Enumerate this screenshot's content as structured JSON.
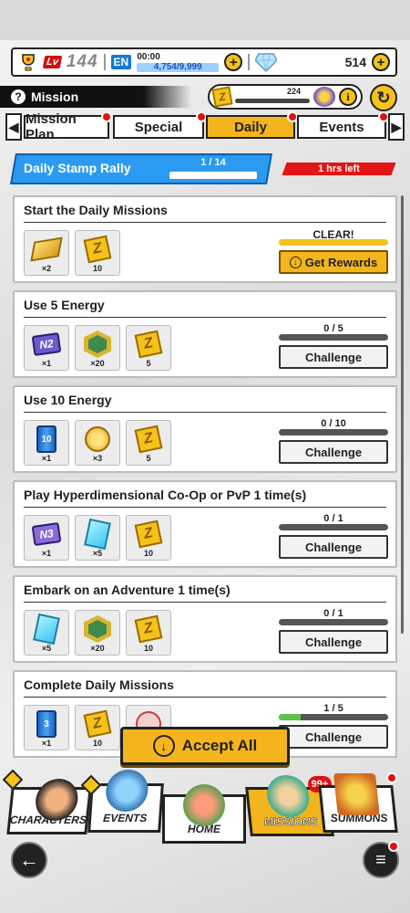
{
  "player": {
    "level_tag": "Lv",
    "level": "144",
    "en_tag": "EN",
    "en_timer": "00:00",
    "energy": "4,754/9,999",
    "gems": "514"
  },
  "header": {
    "title": "Mission",
    "z_points": "224"
  },
  "tabs": [
    {
      "label": "Mission Plan"
    },
    {
      "label": "Special"
    },
    {
      "label": "Daily"
    },
    {
      "label": "Events"
    }
  ],
  "rally": {
    "label": "Daily Stamp Rally",
    "progress": "1 / 14",
    "time_left": "1 hrs left"
  },
  "missions": [
    {
      "title": "Start the Daily Missions",
      "rewards": [
        {
          "icon": "gold-ingot-icon",
          "qty": "×2"
        },
        {
          "icon": "z-point-icon",
          "qty": "10"
        }
      ],
      "status_label": "CLEAR!",
      "button": "Get Rewards",
      "fill": 1.0
    },
    {
      "title": "Use 5 Energy",
      "rewards": [
        {
          "icon": "n2-ticket-icon",
          "label": "N2",
          "qty": "×1"
        },
        {
          "icon": "hex-medal-icon",
          "qty": "×20"
        },
        {
          "icon": "z-point-icon",
          "qty": "5"
        }
      ],
      "progress": "0 / 5",
      "button": "Challenge",
      "fill": 0
    },
    {
      "title": "Use 10 Energy",
      "rewards": [
        {
          "icon": "energy-can-icon",
          "label": "10",
          "qty": "×1"
        },
        {
          "icon": "gold-coin-icon",
          "qty": "×3"
        },
        {
          "icon": "z-point-icon",
          "qty": "5"
        }
      ],
      "progress": "0 / 10",
      "button": "Challenge",
      "fill": 0
    },
    {
      "title": "Play Hyperdimensional Co-Op or PvP 1 time(s)",
      "rewards": [
        {
          "icon": "n3-ticket-icon",
          "label": "N3",
          "qty": "×1"
        },
        {
          "icon": "blue-card-icon",
          "qty": "×5"
        },
        {
          "icon": "z-point-icon",
          "qty": "10"
        }
      ],
      "progress": "0 / 1",
      "button": "Challenge",
      "fill": 0
    },
    {
      "title": "Embark on an Adventure 1 time(s)",
      "rewards": [
        {
          "icon": "blue-card-icon",
          "qty": "×5"
        },
        {
          "icon": "hex-medal-icon",
          "qty": "×20"
        },
        {
          "icon": "z-point-icon",
          "qty": "10"
        }
      ],
      "progress": "0 / 1",
      "button": "Challenge",
      "fill": 0
    },
    {
      "title": "Complete Daily Missions",
      "rewards": [
        {
          "icon": "energy-can-icon",
          "label": "3",
          "qty": "×1"
        },
        {
          "icon": "z-point-icon",
          "qty": "10"
        },
        {
          "icon": "red-token-icon",
          "qty": ""
        }
      ],
      "progress": "1 / 5",
      "button": "Challenge",
      "fill": 0.2
    }
  ],
  "accept_all": "Accept All",
  "nav": {
    "characters": "CHARACTERS",
    "events": "EVENTS",
    "home": "HOME",
    "missions": "MISSIONS",
    "summons": "SUMMONS",
    "badge": "99+"
  },
  "colors": {
    "accent": "#f4b51c",
    "rally": "#2b9bf2",
    "alert": "#e31515",
    "progress_fill": "#5cc24a"
  }
}
